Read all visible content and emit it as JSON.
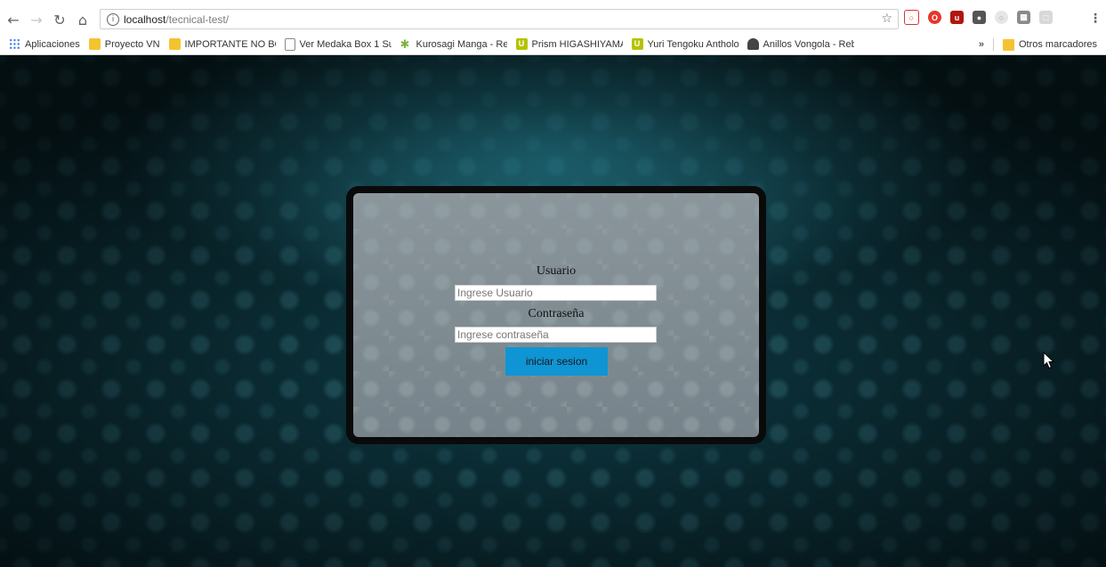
{
  "browser": {
    "url_host": "localhost",
    "url_path": "/tecnical-test/",
    "bookmarks": [
      {
        "label": "Aplicaciones",
        "icon": "apps-icon"
      },
      {
        "label": "Proyecto VN",
        "icon": "folder-icon"
      },
      {
        "label": "IMPORTANTE NO BO",
        "icon": "folder-icon"
      },
      {
        "label": "Ver Medaka Box 1 Su",
        "icon": "page-icon"
      },
      {
        "label": "Kurosagi Manga - Re",
        "icon": "star-green-icon"
      },
      {
        "label": "Prism HIGASHIYAMA",
        "icon": "u-icon"
      },
      {
        "label": "Yuri Tengoku Antholo",
        "icon": "u-icon"
      },
      {
        "label": "Anillos Vongola - Reb",
        "icon": "hat-icon"
      }
    ],
    "overflow_label": "»",
    "other_bookmarks": "Otros marcadores"
  },
  "login": {
    "user_label": "Usuario",
    "user_placeholder": "Ingrese Usuario",
    "password_label": "Contraseña",
    "password_placeholder": "Ingrese contraseña",
    "submit_label": "iniciar sesion"
  },
  "colors": {
    "button": "#0f95d3",
    "background": "#0e3a44"
  }
}
